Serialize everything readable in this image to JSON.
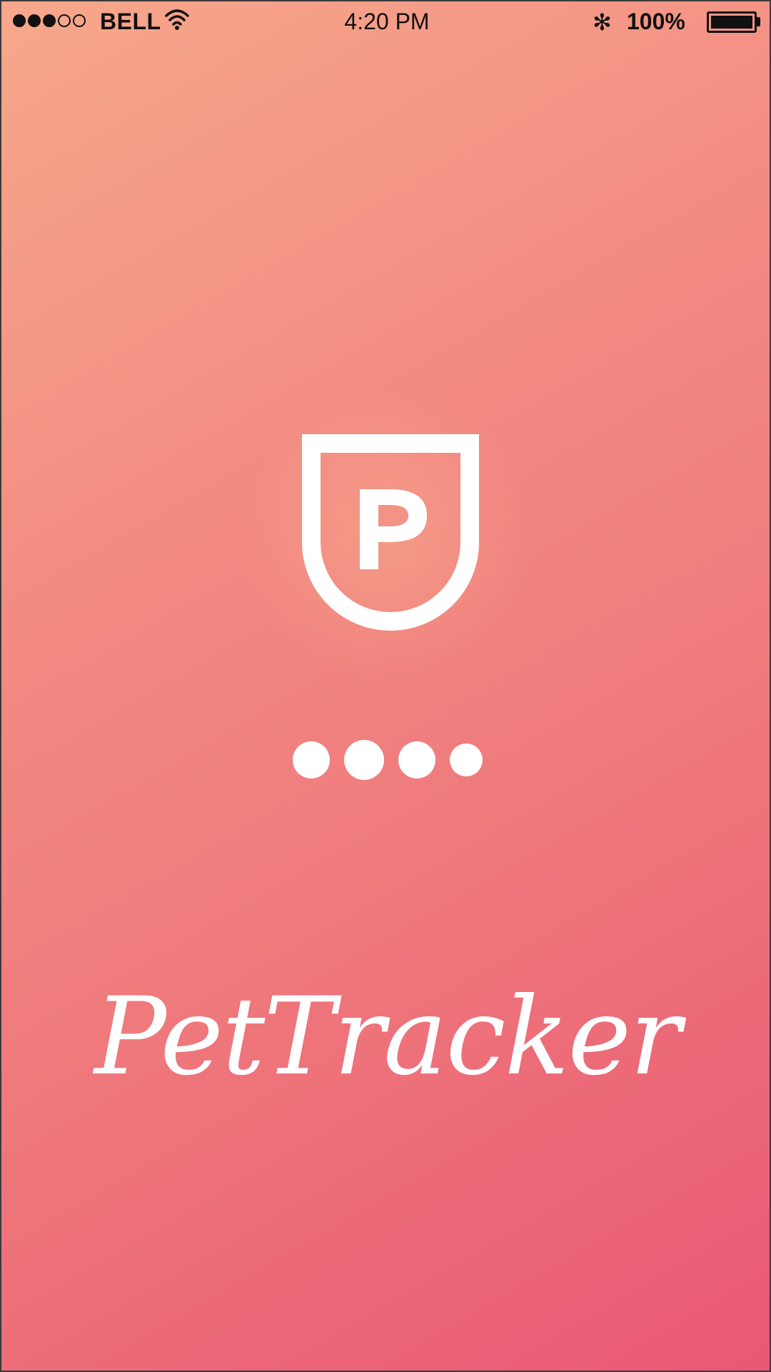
{
  "status_bar": {
    "signal_bars_filled": 3,
    "signal_bars_total": 5,
    "carrier": "BELL",
    "wifi_icon": "wifi-icon",
    "time": "4:20 PM",
    "bluetooth_icon": "bluetooth-icon",
    "bluetooth_symbol": "✻",
    "battery_percent": "100%",
    "battery_level": 1.0
  },
  "splash": {
    "logo_icon": "shield-p-logo-icon",
    "loading_icon": "loading-dots-icon",
    "loading_dot_count": 4,
    "app_name": "PetTracker"
  },
  "colors": {
    "gradient_top_left": "#f7a88b",
    "gradient_bottom_right": "#e95874",
    "foreground": "#ffffff",
    "status_text": "#111111"
  }
}
